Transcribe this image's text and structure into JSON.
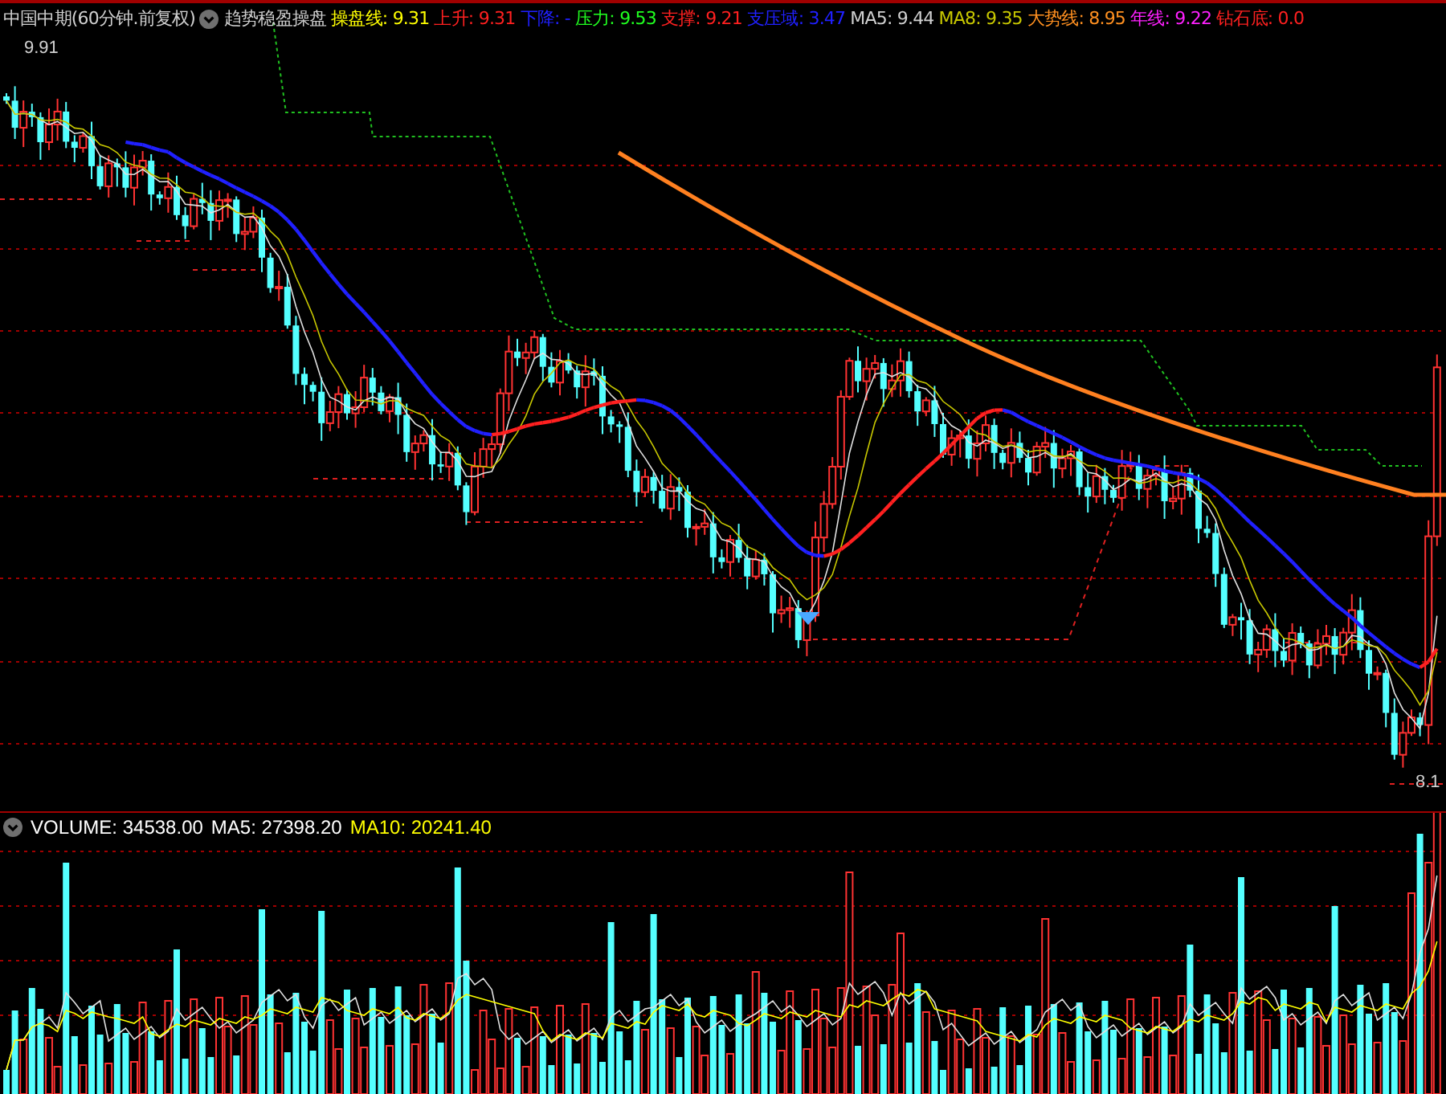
{
  "header": {
    "title": "中国中期(60分钟.前复权)",
    "indicator": "趋势稳盈操盘",
    "legend": [
      {
        "label": "操盘线:",
        "value": "9.31",
        "color": "#ffff00"
      },
      {
        "label": "上升:",
        "value": "9.31",
        "color": "#ff2020"
      },
      {
        "label": "下降:",
        "value": "-",
        "color": "#2020ff"
      },
      {
        "label": "压力:",
        "value": "9.53",
        "color": "#20ff20"
      },
      {
        "label": "支撑:",
        "value": "9.21",
        "color": "#ff2020"
      },
      {
        "label": "支压域:",
        "value": "3.47",
        "color": "#2020ff"
      },
      {
        "label": "MA5:",
        "value": "9.44",
        "color": "#d0d0d0"
      },
      {
        "label": "MA8:",
        "value": "9.35",
        "color": "#c8c800"
      },
      {
        "label": "大势线:",
        "value": "8.95",
        "color": "#ff9020"
      },
      {
        "label": "年线:",
        "value": "9.22",
        "color": "#ff20ff"
      },
      {
        "label": "钻石底:",
        "value": "0.0",
        "color": "#ff2020"
      }
    ]
  },
  "price_chart": {
    "high_label": "9.91",
    "low_label": "8.1"
  },
  "volume_panel": {
    "legend": [
      {
        "label": "VOLUME:",
        "value": "34538.00",
        "color": "#ffffff"
      },
      {
        "label": "MA5:",
        "value": "27398.20",
        "color": "#ffffff"
      },
      {
        "label": "MA10:",
        "value": "20241.40",
        "color": "#ffff00"
      }
    ]
  }
}
